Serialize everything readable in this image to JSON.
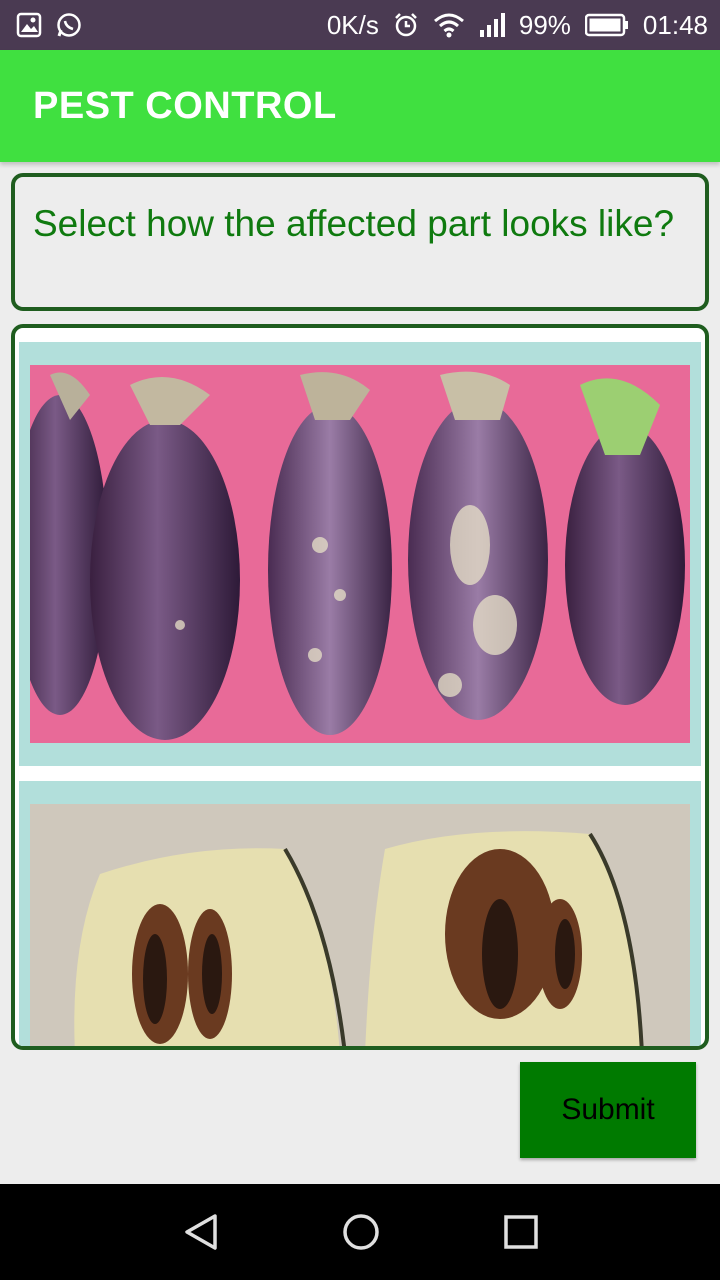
{
  "status_bar": {
    "net_speed": "0K/s",
    "battery": "99%",
    "time": "01:48",
    "icons": [
      "gallery-icon",
      "whatsapp-icon",
      "alarm-icon",
      "wifi-icon",
      "signal-icon",
      "battery-icon"
    ]
  },
  "app_bar": {
    "title": "PEST CONTROL",
    "color": "#40e040"
  },
  "question": {
    "text": "Select how the affected part looks like?",
    "color": "#0f7a0f"
  },
  "options": [
    {
      "image": "brinjal-fruits-damaged-skin-photo"
    },
    {
      "image": "brinjal-cut-open-bored-inside-photo"
    }
  ],
  "submit": {
    "label": "Submit",
    "color": "#007a00"
  },
  "nav_bar": {
    "buttons": [
      "back-icon",
      "home-icon",
      "recents-icon"
    ]
  }
}
